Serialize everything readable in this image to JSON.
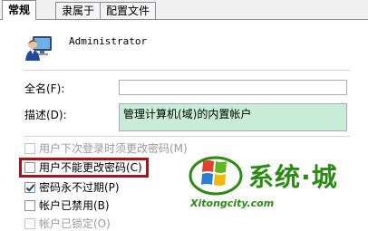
{
  "tabs": [
    {
      "label": "常规",
      "active": true
    },
    {
      "label": "隶属于",
      "active": false
    },
    {
      "label": "配置文件",
      "active": false
    }
  ],
  "user": {
    "name": "Administrator",
    "icon": "user-computer-icon"
  },
  "fields": {
    "full_name_label": "全名(F):",
    "full_name_value": "",
    "description_label": "描述(D):",
    "description_value": "管理计算机(域)的内置帐户"
  },
  "checkboxes": [
    {
      "label": "用户下次登录时须更改密码(M)",
      "checked": false,
      "enabled": false
    },
    {
      "label": "用户不能更改密码(C)",
      "checked": false,
      "enabled": true
    },
    {
      "label": "密码永不过期(P)",
      "checked": true,
      "enabled": true
    },
    {
      "label": "帐户已禁用(B)",
      "checked": false,
      "enabled": true
    },
    {
      "label": "帐户已锁定(O)",
      "checked": false,
      "enabled": false
    }
  ],
  "watermark": {
    "brand": "系统·城",
    "url": "Xitongcity.com"
  },
  "colors": {
    "highlight": "#a8121a",
    "description_bg": "#c7ecd7",
    "watermark": "#2a8a12"
  }
}
